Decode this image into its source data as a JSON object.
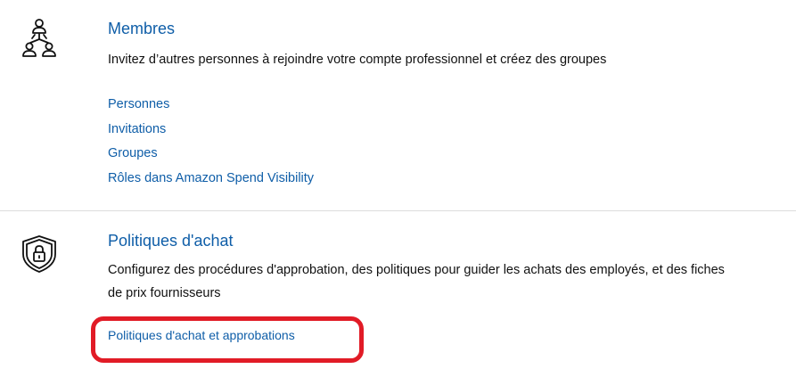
{
  "members": {
    "icon": "people-network-icon",
    "title": "Membres",
    "description": "Invitez d’autres personnes à rejoindre votre compte professionnel et créez des groupes",
    "links": [
      "Personnes",
      "Invitations",
      "Groupes",
      "Rôles dans Amazon Spend Visibility"
    ]
  },
  "purchase_policies": {
    "icon": "shield-lock-icon",
    "title": "Politiques d'achat",
    "description_line1": "Configurez des procédures d'approbation, des politiques pour guider les achats des employés, et des fiches",
    "description_line2": "de prix fournisseurs",
    "link": "Politiques d'achat et approbations"
  },
  "colors": {
    "link": "#0f5ea8",
    "highlight": "#e11b26",
    "divider": "#dddddd"
  }
}
